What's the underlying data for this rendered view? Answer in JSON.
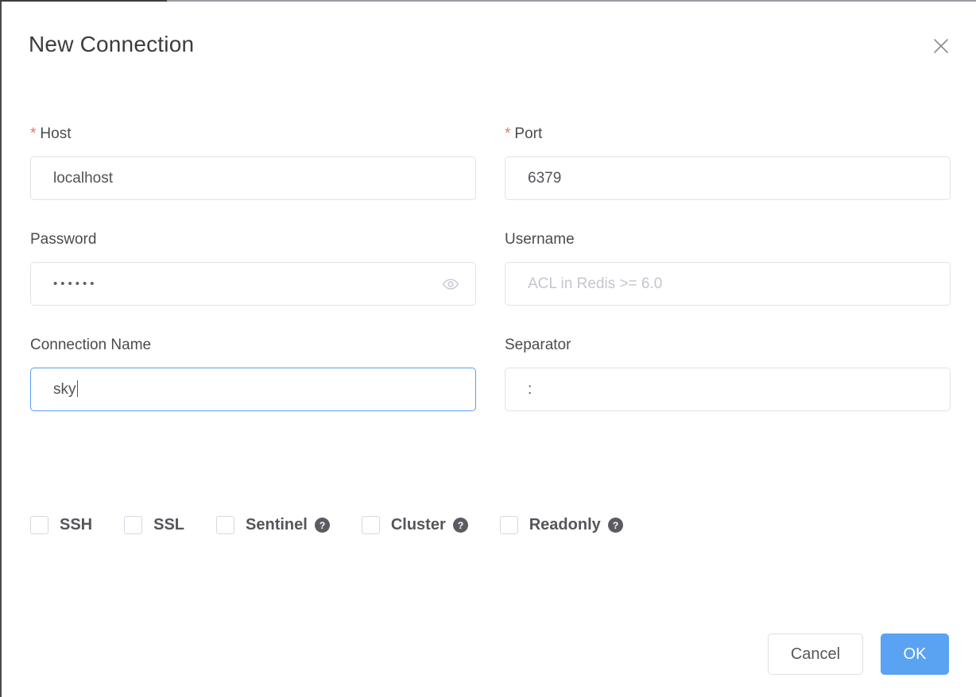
{
  "dialog": {
    "title": "New Connection",
    "close_icon": "close-icon"
  },
  "form": {
    "rows": [
      {
        "left": {
          "label": "Host",
          "required": true,
          "required_marker": "*",
          "value": "localhost",
          "placeholder": "",
          "focused": false
        },
        "right": {
          "label": "Port",
          "required": true,
          "required_marker": "*",
          "value": "6379",
          "placeholder": "",
          "focused": false
        }
      },
      {
        "left": {
          "label": "Password",
          "required": false,
          "value": "••••••",
          "placeholder": "",
          "focused": false,
          "has_eye_toggle": true,
          "eye_icon": "eye-icon"
        },
        "right": {
          "label": "Username",
          "required": false,
          "value": "",
          "placeholder": "ACL in Redis >= 6.0",
          "focused": false
        }
      },
      {
        "left": {
          "label": "Connection Name",
          "required": false,
          "value": "sky",
          "placeholder": "",
          "focused": true,
          "has_caret": true
        },
        "right": {
          "label": "Separator",
          "required": false,
          "value": ":",
          "placeholder": "",
          "focused": false
        }
      }
    ]
  },
  "options": [
    {
      "label": "SSH",
      "checked": false,
      "help": false
    },
    {
      "label": "SSL",
      "checked": false,
      "help": false
    },
    {
      "label": "Sentinel",
      "checked": false,
      "help": true,
      "help_icon": "help-icon"
    },
    {
      "label": "Cluster",
      "checked": false,
      "help": true,
      "help_icon": "help-icon"
    },
    {
      "label": "Readonly",
      "checked": false,
      "help": true,
      "help_icon": "help-icon"
    }
  ],
  "footer": {
    "cancel_label": "Cancel",
    "ok_label": "OK"
  },
  "colors": {
    "accent": "#5aa2f2",
    "required_star": "#f56c6c",
    "label_text": "#4a4b4f",
    "input_border": "#dfe2e8",
    "focus_border": "#5a9ef5",
    "placeholder_text": "#c3c6ce",
    "help_icon": "#5b5c61"
  }
}
